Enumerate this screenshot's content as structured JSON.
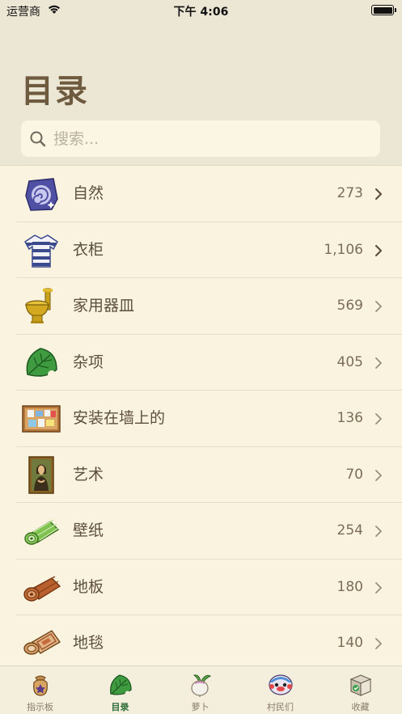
{
  "status_bar": {
    "carrier": "运营商",
    "time": "下午 4:06"
  },
  "page_title": "目录",
  "search": {
    "placeholder": "搜索..."
  },
  "categories": [
    {
      "label": "自然",
      "count": "273",
      "icon": "fossil-shell-icon"
    },
    {
      "label": "衣柜",
      "count": "1,106",
      "icon": "striped-shirt-icon"
    },
    {
      "label": "家用器皿",
      "count": "569",
      "icon": "golden-toilet-icon"
    },
    {
      "label": "杂项",
      "count": "405",
      "icon": "leaf-icon"
    },
    {
      "label": "安装在墙上的",
      "count": "136",
      "icon": "bulletin-board-icon"
    },
    {
      "label": "艺术",
      "count": "70",
      "icon": "painting-icon"
    },
    {
      "label": "壁纸",
      "count": "254",
      "icon": "wallpaper-roll-icon"
    },
    {
      "label": "地板",
      "count": "180",
      "icon": "flooring-roll-icon"
    },
    {
      "label": "地毯",
      "count": "140",
      "icon": "rug-icon"
    }
  ],
  "tabs": [
    {
      "label": "指示板",
      "icon": "bell-bag-icon",
      "active": false
    },
    {
      "label": "目录",
      "icon": "leaf-icon",
      "active": true
    },
    {
      "label": "萝卜",
      "icon": "turnip-icon",
      "active": false
    },
    {
      "label": "村民们",
      "icon": "villager-face-icon",
      "active": false
    },
    {
      "label": "收藏",
      "icon": "collection-box-icon",
      "active": false
    }
  ],
  "colors": {
    "accent": "#2f6e3a",
    "background": "#faf3df",
    "header": "#ece6d4"
  }
}
